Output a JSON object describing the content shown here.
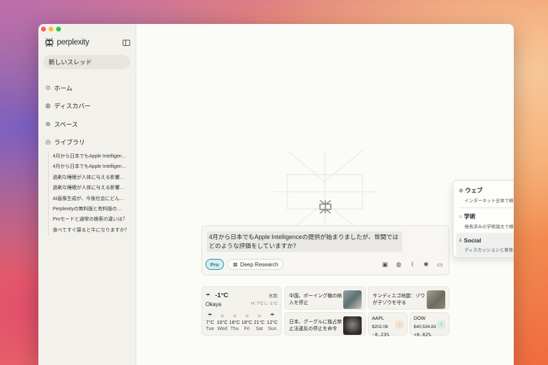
{
  "app": {
    "brand": "perplexity"
  },
  "sidebar": {
    "new_thread": "新しいスレッド",
    "nav": [
      {
        "label": "ホーム",
        "icon": "home-icon"
      },
      {
        "label": "ディスカバー",
        "icon": "globe-icon"
      },
      {
        "label": "スペース",
        "icon": "spaces-icon"
      },
      {
        "label": "ライブラリ",
        "icon": "library-icon"
      }
    ],
    "library_items": [
      "4月から日本でもApple Intelligen…",
      "4月から日本でもApple Intelligen…",
      "過剰な睡眠が人体に与える影響…",
      "過剰な睡眠が人体に与える影響…",
      "AI画像生成が、今後社会にどん…",
      "Perplexityの無料版と有料版の…",
      "Proモードと通常の検索の違いは？",
      "食べてすぐ寝ると牛になりますか？"
    ]
  },
  "search": {
    "query": "4月から日本でもApple Intelligenceの提供が始まりましたが、世間ではどのような評価をしていますか？",
    "pro_label": "Pro",
    "deep_research_label": "Deep Research",
    "tools": [
      "cpu-icon",
      "globe-icon",
      "paperclip-icon",
      "mic-icon",
      "window-icon"
    ]
  },
  "source_menu": {
    "items": [
      {
        "title": "ウェブ",
        "desc": "インターネット全体で検索",
        "icon": "globe-icon",
        "selected": false
      },
      {
        "title": "学術",
        "desc": "発表済みの学術論文で検索",
        "icon": "academic-icon",
        "selected": false
      },
      {
        "title": "Social",
        "desc": "ディスカッションと意見を検索",
        "icon": "people-icon",
        "selected": true
      }
    ]
  },
  "widgets": {
    "weather": {
      "temp": "-1°C",
      "condition": "氷雨",
      "city": "Okaya",
      "hilo": "H: 7°C L: -1°C",
      "forecast": [
        {
          "temp": "7°C",
          "day": "Tue",
          "icon": "rain-icon"
        },
        {
          "temp": "10°C",
          "day": "Wed",
          "icon": "sun-icon"
        },
        {
          "temp": "18°C",
          "day": "Thu",
          "icon": "sun-icon"
        },
        {
          "temp": "18°C",
          "day": "Fri",
          "icon": "sun-icon"
        },
        {
          "temp": "21°C",
          "day": "Sat",
          "icon": "sun-icon"
        },
        {
          "temp": "12°C",
          "day": "Sun",
          "icon": "rain-icon"
        }
      ]
    },
    "news": [
      {
        "text": "中国、ボーイング機の納入を停止"
      },
      {
        "text": "サンディエゴ地震：ゾウが子ゾウを守る"
      },
      {
        "text": "日本、グーグルに独占禁止法違反の停止を命令"
      }
    ],
    "stocks": [
      {
        "name": "AAPL",
        "price": "$202.06",
        "change": "-0.23%",
        "direction": "down",
        "color": "#d98b4a"
      },
      {
        "name": "DOW",
        "price": "$40,534.83",
        "change": "+0.62%",
        "direction": "up",
        "color": "#2f9c7c"
      }
    ]
  },
  "colors": {
    "accent": "#1f7c90",
    "sidebar_bg": "#f2f1ec",
    "main_bg": "#fbfbf8"
  }
}
